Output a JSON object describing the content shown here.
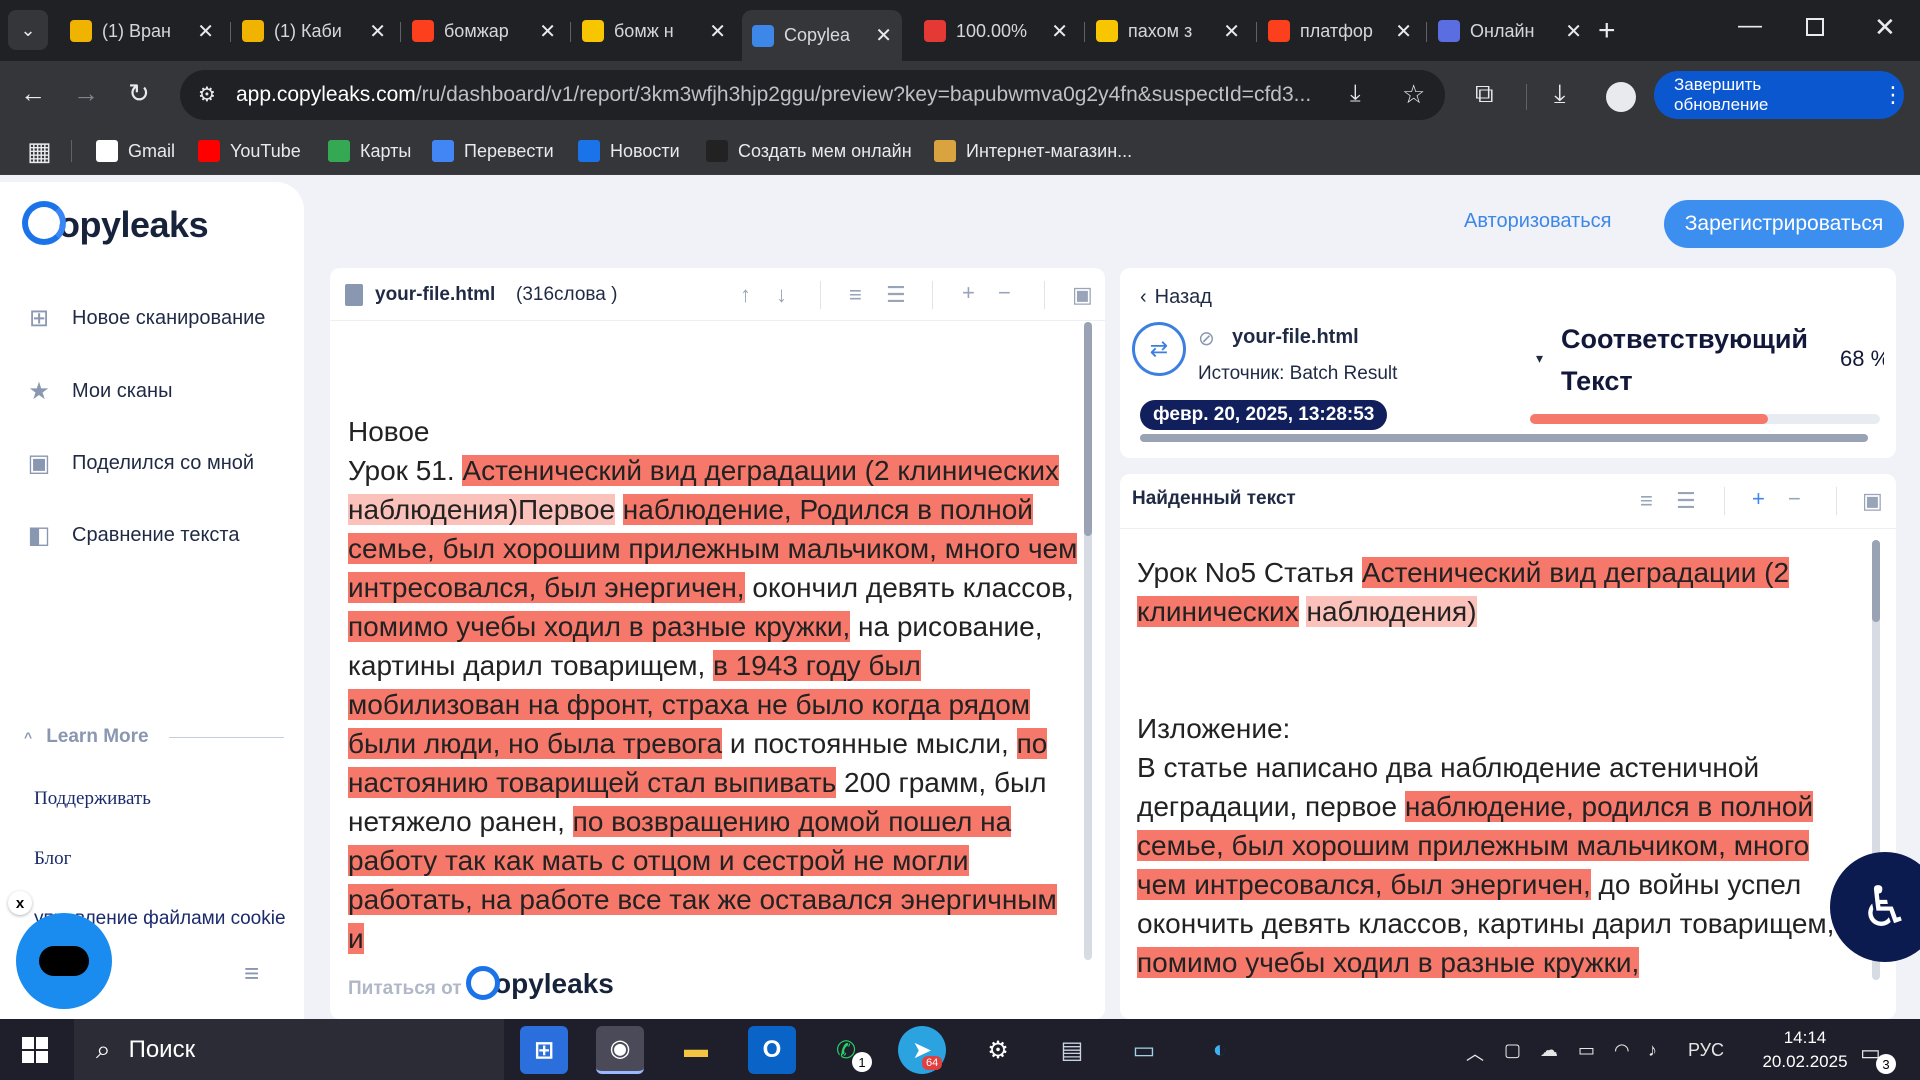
{
  "browser": {
    "tabs": [
      {
        "title": "(1) Вран",
        "icon": "zoom-dollar-icon",
        "color": "#f0b400"
      },
      {
        "title": "(1) Каби",
        "icon": "zoom-dollar-icon",
        "color": "#f0b400"
      },
      {
        "title": "бомжар",
        "icon": "yandex-icon",
        "color": "#fc3f1d"
      },
      {
        "title": "бомж н",
        "icon": "yandex-images-icon",
        "color": "#f7c600"
      },
      {
        "title": "Copylea",
        "icon": "copyleaks-icon",
        "color": "#3d87e8",
        "active": true
      },
      {
        "title": "100.00%",
        "icon": "antiplagiat-icon",
        "color": "#e53935"
      },
      {
        "title": "пахом з",
        "icon": "yandex-images-icon",
        "color": "#f7c600"
      },
      {
        "title": "платфор",
        "icon": "yandex-icon",
        "color": "#fc3f1d"
      },
      {
        "title": "Онлайн",
        "icon": "online-app-icon",
        "color": "#5b6ee1"
      }
    ],
    "url_host": "app.copyleaks.com",
    "url_rest": "/ru/dashboard/v1/report/3km3wfjh3hjp2ggu/preview?key=bapubwmva0g2y4fn&suspectId=cfd3...",
    "update_button": "Завершить обновление",
    "bookmarks": [
      {
        "label": "Gmail",
        "icon": "google-icon"
      },
      {
        "label": "YouTube",
        "icon": "youtube-icon"
      },
      {
        "label": "Карты",
        "icon": "maps-icon"
      },
      {
        "label": "Перевести",
        "icon": "translate-icon"
      },
      {
        "label": "Новости",
        "icon": "news-icon"
      },
      {
        "label": "Создать мем онлайн",
        "icon": "meme-icon"
      },
      {
        "label": "Интернет-магазин...",
        "icon": "store-icon"
      }
    ]
  },
  "sidebar": {
    "logo": "opyleaks",
    "items": [
      {
        "label": "Новое сканирование",
        "icon": "new-scan-icon"
      },
      {
        "label": "Мои сканы",
        "icon": "folder-star-icon"
      },
      {
        "label": "Поделился со мной",
        "icon": "shared-folder-icon"
      },
      {
        "label": "Сравнение текста",
        "icon": "compare-icon"
      }
    ],
    "learn_more": "Learn More",
    "links": [
      "Поддерживать",
      "Блог",
      "управление файлами cookie"
    ]
  },
  "header": {
    "login": "Авторизоваться",
    "register": "Зарегистрироваться"
  },
  "left_panel": {
    "filename": "your-file.html",
    "wordcount": "(316слова )",
    "footer_prefix": "Питаться от",
    "footer_logo": "opyleaks"
  },
  "right_top": {
    "back": "Назад",
    "filename": "your-file.html",
    "source": "Источник: Batch Result",
    "date": "февр. 20, 2025, 13:28:53",
    "match_title": "Соответствующий Текст",
    "match_pct": "68 %",
    "match_fraction": 0.68
  },
  "right_main": {
    "title": "Найденный текст"
  },
  "taskbar": {
    "search": "Поиск",
    "lang": "РУС",
    "time": "14:14",
    "date": "20.02.2025",
    "notif_count": "3",
    "whatsapp_badge": "1",
    "telegram_badge": "64"
  },
  "colors": {
    "highlight_strong": "#f5786a",
    "highlight_soft": "#fbc2bb",
    "brand_blue": "#3d8fef"
  }
}
